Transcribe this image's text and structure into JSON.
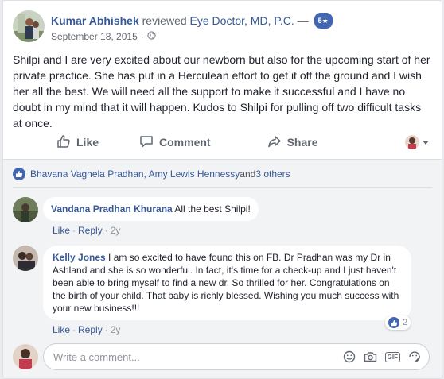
{
  "post": {
    "author": "Kumar Abhishek",
    "action": "reviewed",
    "page": "Eye Doctor, MD, P.C.",
    "separator": "—",
    "rating": "5",
    "date": "September 18, 2015",
    "dot": "·",
    "privacy_icon": "globe-icon",
    "text": "Shilpi and I are very excited about our newborn but also for the upcoming start of her private practice. She has put in a Herculean effort to get it off the ground and I wish her all the best. We will need all the support to make it successful and I have no doubt in my mind that it will happen. Kudos to Shilpi for pulling off two difficult tasks at once."
  },
  "actions": {
    "like": "Like",
    "comment": "Comment",
    "share": "Share"
  },
  "reactions": {
    "names": "Bhavana Vaghela Pradhan, Amy Lewis Hennessy",
    "and": " and ",
    "others": "3 others"
  },
  "comments": [
    {
      "author": "Vandana Pradhan Khurana",
      "text": "All the best Shilpi!",
      "like": "Like",
      "reply": "Reply",
      "time": "2y"
    },
    {
      "author": "Kelly Jones",
      "text": "I am so excited to have found this on FB. Dr Pradhan was my Dr in Ashland and she is so wonderful. In fact, it's time for a check-up and I just haven't been able to bring myself to find a new dr. So thrilled for her. Congratulations on the birth of your child. That baby is richly blessed. Wishing you much success with your new business!!!",
      "like": "Like",
      "reply": "Reply",
      "time": "2y",
      "reaction_count": "2"
    }
  ],
  "composer": {
    "placeholder": "Write a comment..."
  },
  "colors": {
    "link": "#365899",
    "brand": "#4267b2",
    "meta": "#616770",
    "background": "#f2f3f5"
  }
}
